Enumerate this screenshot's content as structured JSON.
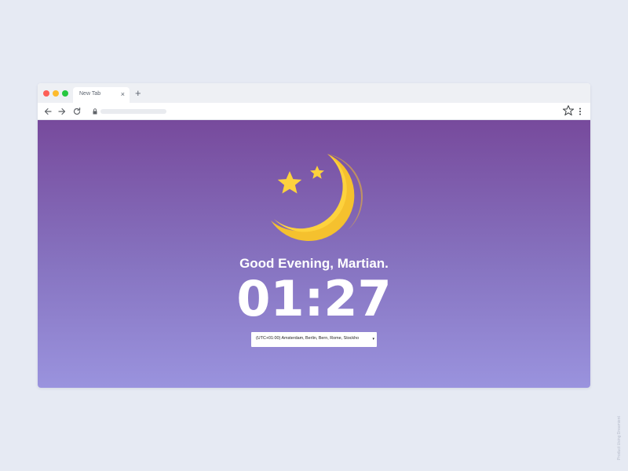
{
  "browser": {
    "tab": {
      "title": "New Tab",
      "close_glyph": "×"
    },
    "new_tab_glyph": "+"
  },
  "page": {
    "greeting": "Good Evening, Martian.",
    "time": "01:27",
    "timezone": {
      "selected": "(UTC+01:00) Amsterdam, Berlin, Bern, Rome, Stockho",
      "arrow_glyph": "▾"
    },
    "illustration": "crescent-moon-with-stars-icon"
  },
  "credit": "Product Using Dreamient",
  "colors": {
    "background": "#e6eaf3",
    "gradient_top": "#774a9c",
    "gradient_bottom": "#9a93de",
    "moon": "#fdd23d",
    "moon_shadow": "#f5c12e",
    "text": "#ffffff"
  }
}
